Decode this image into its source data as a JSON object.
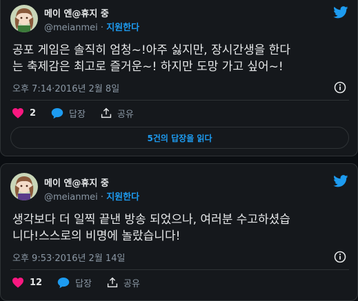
{
  "colors": {
    "background": "#0b0e12",
    "card": "#15181c",
    "accent": "#1d9bf0",
    "like": "#f91880",
    "muted": "#8b98a5",
    "text": "#e7e9ea"
  },
  "icons": {
    "brand": "twitter-bird-icon",
    "info": "info-icon",
    "like": "heart-icon",
    "reply": "speech-bubble-icon",
    "share": "share-upload-icon"
  },
  "tweets": [
    {
      "display_name": "메이 엔@휴지 중",
      "handle": "@meianmei",
      "separator": "·",
      "follow_label": "지원한다",
      "text": "공포 게임은 솔직히 엄청~!아주 싫지만, 장시간생을 한다\n는 축제감은 최고로 즐거운~! 하지만 도망 가고 싶어~!",
      "timestamp": "오후 7:14·2016년 2월 8일",
      "like_count": "2",
      "reply_label": "답장",
      "share_label": "공유",
      "replies_button": "5건의 답장을 읽다"
    },
    {
      "display_name": "메이 엔@휴지 중",
      "handle": "@meianmei",
      "separator": "·",
      "follow_label": "지원한다",
      "text": "생각보다 더 일찍 끝낸 방송 되었으나, 여러분 수고하셨습\n니다!스스로의 비명에 놀랐습니다!",
      "timestamp": "오후 9:53·2016년 2월 14일",
      "like_count": "12",
      "reply_label": "답장",
      "share_label": "공유"
    }
  ]
}
